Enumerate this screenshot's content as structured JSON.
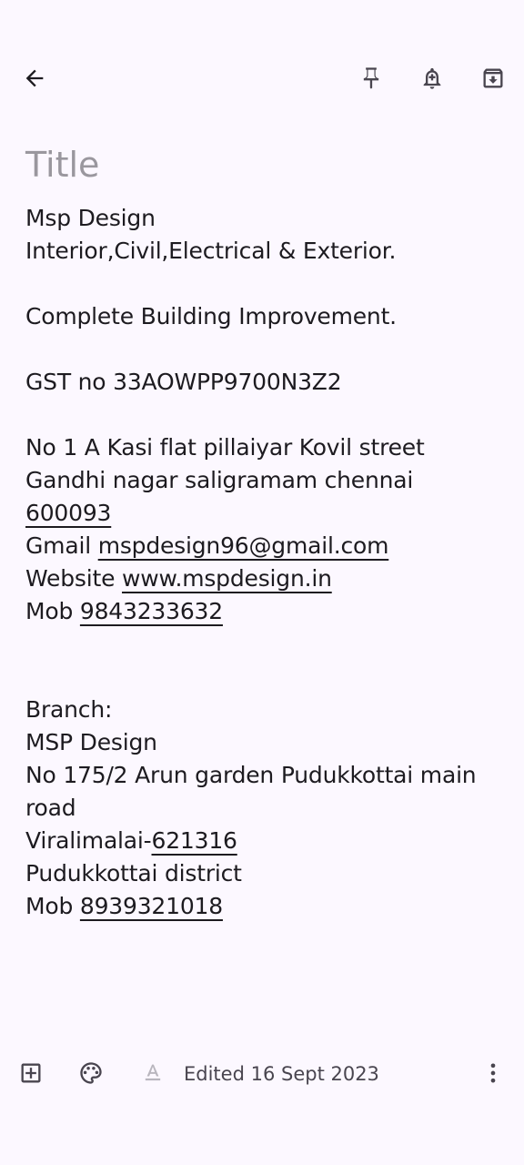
{
  "toolbar": {
    "back_icon": "arrow-left-icon",
    "pin_icon": "pin-icon",
    "reminder_icon": "bell-plus-icon",
    "archive_icon": "archive-icon"
  },
  "note": {
    "title_placeholder": "Title",
    "lines": [
      "Msp Design",
      "Interior,Civil,Electrical & Exterior.",
      "",
      "Complete Building Improvement.",
      "",
      "GST no 33AOWPP9700N3Z2",
      "",
      "No 1 A Kasi flat pillaiyar Kovil street",
      "Gandhi nagar saligramam chennai",
      "600093",
      "Gmail ",
      "mspdesign96@gmail.com",
      "Website ",
      "www.mspdesign.in",
      "Mob ",
      "9843233632",
      "",
      "",
      "Branch:",
      "MSP Design",
      "No 175/2 Arun garden Pudukkottai main road",
      "Viralimalai-",
      "621316",
      "Pudukkottai district",
      "Mob ",
      "8939321018"
    ]
  },
  "bottombar": {
    "add_icon": "add-box-icon",
    "palette_icon": "palette-icon",
    "text_format_icon": "text-format-icon",
    "edited_text": "Edited 16 Sept 2023",
    "more_icon": "more-vert-icon"
  },
  "colors": {
    "background": "#fcf8ff",
    "text": "#1d1b20",
    "placeholder": "#9a979e",
    "muted": "#49454f"
  }
}
